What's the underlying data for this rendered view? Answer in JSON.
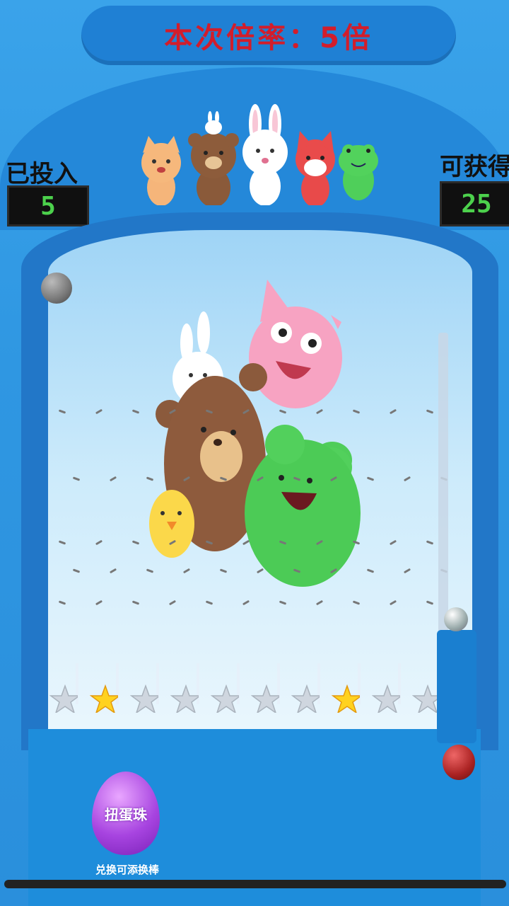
{
  "header": {
    "rate_text": "本次倍率：5倍"
  },
  "counters": {
    "invested_label": "已投入",
    "invested_value": "5",
    "winnable_label": "可获得",
    "winnable_value": "25"
  },
  "controls": {
    "egg_button_label": "扭蛋珠",
    "egg_caption": "兑换可添换棒"
  },
  "mascots": [
    "cat-icon",
    "bear-icon",
    "bunny-icon",
    "fox-icon",
    "frog-icon"
  ],
  "slots": {
    "count": 10,
    "star_slots": [
      1,
      7
    ]
  },
  "colors": {
    "accent_red": "#d21d2b",
    "counter_green": "#4cd14c",
    "board_blue": "#2277c8"
  }
}
